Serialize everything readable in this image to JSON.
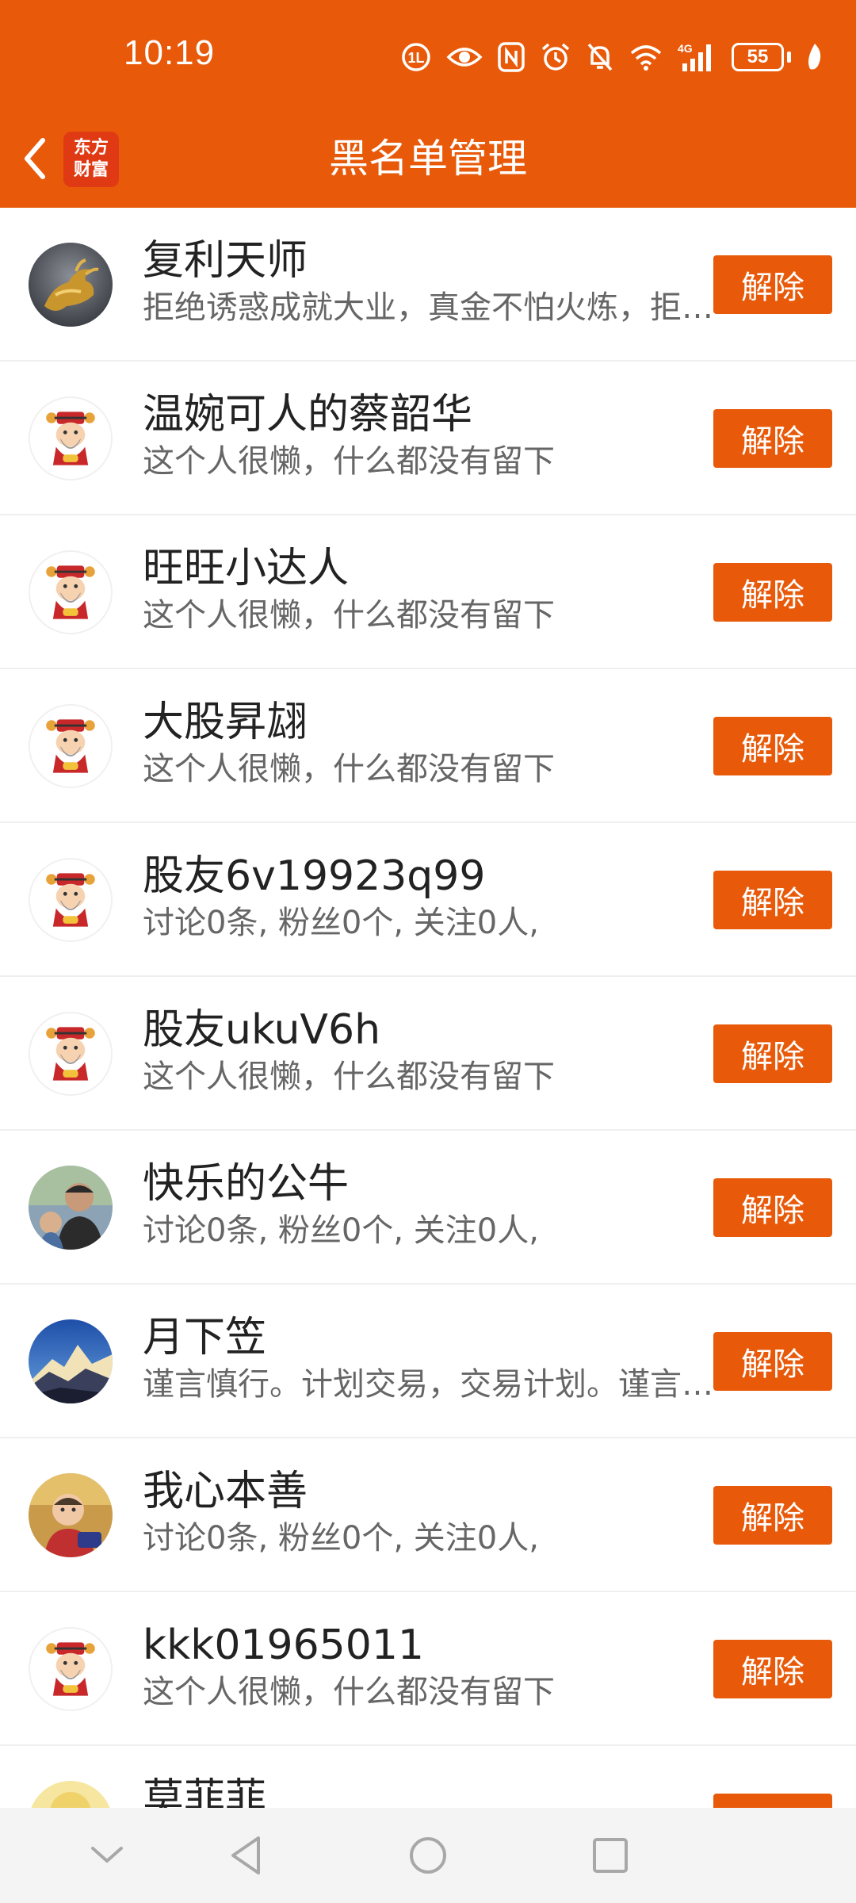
{
  "status_bar": {
    "time": "10:19",
    "battery": "55",
    "icons": [
      "hd-call-icon",
      "eye-icon",
      "nfc-icon",
      "alarm-icon",
      "mute-icon",
      "wifi-icon",
      "4g-signal-icon",
      "battery-icon",
      "leaf-icon"
    ]
  },
  "header": {
    "title": "黑名单管理",
    "logo_line1": "东方",
    "logo_line2": "财富"
  },
  "colors": {
    "accent": "#E85A0A",
    "divider": "#EFEFEF",
    "nav_bg": "#F4F4F4"
  },
  "remove_label": "解除",
  "users": [
    {
      "name": "复利天师",
      "desc": "拒绝诱惑成就大业，真金不怕火炼，拒绝诱惑成就大业",
      "avatar": "golden-bull-avatar"
    },
    {
      "name": "温婉可人的蔡韶华",
      "desc": "这个人很懒，什么都没有留下",
      "avatar": "default-god-avatar"
    },
    {
      "name": "旺旺小达人",
      "desc": "这个人很懒，什么都没有留下",
      "avatar": "default-god-avatar"
    },
    {
      "name": "大股昇翃",
      "desc": "这个人很懒，什么都没有留下",
      "avatar": "default-god-avatar"
    },
    {
      "name": "股友6v19923q99",
      "desc": "讨论0条, 粉丝0个, 关注0人,",
      "avatar": "default-god-avatar"
    },
    {
      "name": "股友ukuV6h",
      "desc": "这个人很懒，什么都没有留下",
      "avatar": "default-god-avatar"
    },
    {
      "name": "快乐的公牛",
      "desc": "讨论0条, 粉丝0个, 关注0人,",
      "avatar": "photo-man-avatar"
    },
    {
      "name": "月下笠",
      "desc": "谨言慎行。计划交易，交易计划。谨言慎行。计划交易",
      "avatar": "mountain-avatar"
    },
    {
      "name": "我心本善",
      "desc": "讨论0条, 粉丝0个, 关注0人,",
      "avatar": "photo-child-avatar"
    },
    {
      "name": "kkk01965011",
      "desc": "这个人很懒，什么都没有留下",
      "avatar": "default-god-avatar"
    },
    {
      "name": "莫菲菲",
      "desc": "",
      "avatar": "yellow-avatar"
    }
  ],
  "nav": {
    "icons": [
      "collapse-icon",
      "back-triangle-icon",
      "home-circle-icon",
      "recents-square-icon"
    ]
  }
}
